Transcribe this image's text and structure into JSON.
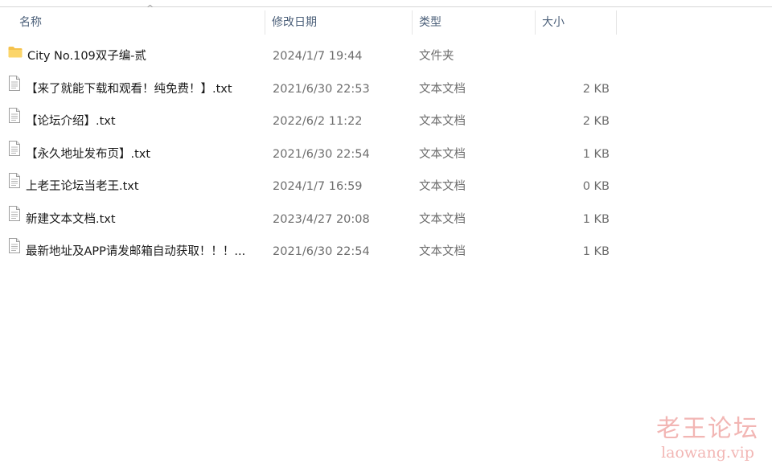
{
  "columns": {
    "name": "名称",
    "date": "修改日期",
    "type": "类型",
    "size": "大小"
  },
  "sort_indicator": "^",
  "files": [
    {
      "icon": "folder-icon",
      "name": "City No.109双子编-贰",
      "date": "2024/1/7 19:44",
      "type": "文件夹",
      "size": ""
    },
    {
      "icon": "text-file-icon",
      "name": "【来了就能下载和观看！纯免费！】.txt",
      "date": "2021/6/30 22:53",
      "type": "文本文档",
      "size": "2 KB"
    },
    {
      "icon": "text-file-icon",
      "name": "【论坛介绍】.txt",
      "date": "2022/6/2 11:22",
      "type": "文本文档",
      "size": "2 KB"
    },
    {
      "icon": "text-file-icon",
      "name": "【永久地址发布页】.txt",
      "date": "2021/6/30 22:54",
      "type": "文本文档",
      "size": "1 KB"
    },
    {
      "icon": "text-file-icon",
      "name": "上老王论坛当老王.txt",
      "date": "2024/1/7 16:59",
      "type": "文本文档",
      "size": "0 KB"
    },
    {
      "icon": "text-file-icon",
      "name": "新建文本文档.txt",
      "date": "2023/4/27 20:08",
      "type": "文本文档",
      "size": "1 KB"
    },
    {
      "icon": "text-file-icon",
      "name": "最新地址及APP请发邮箱自动获取！！！...",
      "date": "2021/6/30 22:54",
      "type": "文本文档",
      "size": "1 KB"
    }
  ],
  "watermark": {
    "title": "老王论坛",
    "url": "laowang.vip"
  },
  "colors": {
    "header_text": "#4c607a",
    "folder": "#f5c24c",
    "watermark": "#f0aaa8"
  }
}
